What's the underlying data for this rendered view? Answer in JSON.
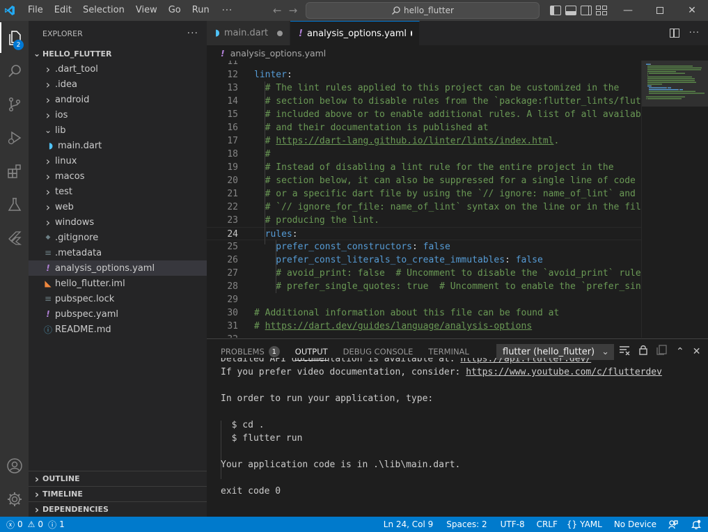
{
  "menu": [
    "File",
    "Edit",
    "Selection",
    "View",
    "Go",
    "Run"
  ],
  "menu_more": "···",
  "command_center": "hello_flutter",
  "activity": {
    "explorer_badge": "2"
  },
  "explorer": {
    "title": "EXPLORER",
    "more": "···",
    "root": "HELLO_FLUTTER",
    "items": [
      {
        "label": ".dart_tool",
        "kind": "folder",
        "icon": "chevron-right-icon"
      },
      {
        "label": ".idea",
        "kind": "folder",
        "icon": "chevron-right-icon"
      },
      {
        "label": "android",
        "kind": "folder",
        "icon": "chevron-right-icon"
      },
      {
        "label": "ios",
        "kind": "folder",
        "icon": "chevron-right-icon"
      },
      {
        "label": "lib",
        "kind": "folder-open",
        "icon": "chevron-down-icon"
      },
      {
        "label": "main.dart",
        "kind": "dart-file",
        "icon": "dart-icon"
      },
      {
        "label": "linux",
        "kind": "folder",
        "icon": "chevron-right-icon"
      },
      {
        "label": "macos",
        "kind": "folder",
        "icon": "chevron-right-icon"
      },
      {
        "label": "test",
        "kind": "folder",
        "icon": "chevron-right-icon"
      },
      {
        "label": "web",
        "kind": "folder",
        "icon": "chevron-right-icon"
      },
      {
        "label": "windows",
        "kind": "folder",
        "icon": "chevron-right-icon"
      },
      {
        "label": ".gitignore",
        "kind": "file",
        "icon": "git-icon"
      },
      {
        "label": ".metadata",
        "kind": "file",
        "icon": "lines-icon"
      },
      {
        "label": "analysis_options.yaml",
        "kind": "yaml",
        "icon": "exclamation-icon"
      },
      {
        "label": "hello_flutter.iml",
        "kind": "file",
        "icon": "rss-icon"
      },
      {
        "label": "pubspec.lock",
        "kind": "file",
        "icon": "lines-icon"
      },
      {
        "label": "pubspec.yaml",
        "kind": "yaml",
        "icon": "exclamation-icon"
      },
      {
        "label": "README.md",
        "kind": "file",
        "icon": "info-icon"
      }
    ],
    "sections": [
      "OUTLINE",
      "TIMELINE",
      "DEPENDENCIES"
    ]
  },
  "tabs": [
    {
      "label": "main.dart",
      "icon": "dart-icon",
      "active": false
    },
    {
      "label": "analysis_options.yaml",
      "icon": "exclamation-icon",
      "active": true
    }
  ],
  "breadcrumb": "analysis_options.yaml",
  "editor": {
    "lines": [
      {
        "n": "11",
        "parts": []
      },
      {
        "n": "12",
        "parts": [
          {
            "t": "linter",
            "c": "k"
          },
          {
            "t": ":",
            "c": "w"
          }
        ]
      },
      {
        "n": "13",
        "parts": [
          {
            "t": "  # The lint rules applied to this project can be customized in the",
            "c": "c"
          }
        ]
      },
      {
        "n": "14",
        "parts": [
          {
            "t": "  # section below to disable rules from the `package:flutter_lints/flutter.yaml`",
            "c": "c"
          }
        ]
      },
      {
        "n": "15",
        "parts": [
          {
            "t": "  # included above or to enable additional rules. A list of all available lints",
            "c": "c"
          }
        ]
      },
      {
        "n": "16",
        "parts": [
          {
            "t": "  # and their documentation is published at",
            "c": "c"
          }
        ]
      },
      {
        "n": "17",
        "parts": [
          {
            "t": "  # ",
            "c": "c"
          },
          {
            "t": "https://dart-lang.github.io/linter/lints/index.html",
            "c": "u"
          },
          {
            "t": ".",
            "c": "c"
          }
        ]
      },
      {
        "n": "18",
        "parts": [
          {
            "t": "  #",
            "c": "c"
          }
        ]
      },
      {
        "n": "19",
        "parts": [
          {
            "t": "  # Instead of disabling a lint rule for the entire project in the",
            "c": "c"
          }
        ]
      },
      {
        "n": "20",
        "parts": [
          {
            "t": "  # section below, it can also be suppressed for a single line of code",
            "c": "c"
          }
        ]
      },
      {
        "n": "21",
        "parts": [
          {
            "t": "  # or a specific dart file by using the `// ignore: name_of_lint` and",
            "c": "c"
          }
        ]
      },
      {
        "n": "22",
        "parts": [
          {
            "t": "  # `// ignore_for_file: name_of_lint` syntax on the line or in the file",
            "c": "c"
          }
        ]
      },
      {
        "n": "23",
        "parts": [
          {
            "t": "  # producing the lint.",
            "c": "c"
          }
        ]
      },
      {
        "n": "24",
        "parts": [
          {
            "t": "  rules",
            "c": "k"
          },
          {
            "t": ":",
            "c": "w"
          }
        ],
        "current": true
      },
      {
        "n": "25",
        "parts": [
          {
            "t": "    prefer_const_constructors",
            "c": "k"
          },
          {
            "t": ": ",
            "c": "w"
          },
          {
            "t": "false",
            "c": "k"
          }
        ]
      },
      {
        "n": "26",
        "parts": [
          {
            "t": "    prefer_const_literals_to_create_immutables",
            "c": "k"
          },
          {
            "t": ": ",
            "c": "w"
          },
          {
            "t": "false",
            "c": "k"
          }
        ]
      },
      {
        "n": "27",
        "parts": [
          {
            "t": "    # avoid_print: false  # Uncomment to disable the `avoid_print` rule",
            "c": "c"
          }
        ]
      },
      {
        "n": "28",
        "parts": [
          {
            "t": "    # prefer_single_quotes: true  # Uncomment to enable the `prefer_single_quotes` rule",
            "c": "c"
          }
        ]
      },
      {
        "n": "29",
        "parts": []
      },
      {
        "n": "30",
        "parts": [
          {
            "t": "# Additional information about this file can be found at",
            "c": "c"
          }
        ]
      },
      {
        "n": "31",
        "parts": [
          {
            "t": "# ",
            "c": "c"
          },
          {
            "t": "https://dart.dev/guides/language/analysis-options",
            "c": "u"
          }
        ]
      },
      {
        "n": "32",
        "parts": []
      }
    ]
  },
  "panel": {
    "tabs": [
      {
        "label": "PROBLEMS",
        "badge": "1",
        "active": false
      },
      {
        "label": "OUTPUT",
        "active": true
      },
      {
        "label": "DEBUG CONSOLE",
        "active": false
      },
      {
        "label": "TERMINAL",
        "active": false
      }
    ],
    "output_channel": "flutter (hello_flutter)",
    "output_lines": [
      {
        "text": "Detailed API documentation is available at: ",
        "link": "https://api.flutter.dev/"
      },
      {
        "text": "If you prefer video documentation, consider: ",
        "link": "https://www.youtube.com/c/flutterdev"
      },
      {
        "text": ""
      },
      {
        "text": "In order to run your application, type:"
      },
      {
        "text": ""
      },
      {
        "text": "  $ cd ."
      },
      {
        "text": "  $ flutter run"
      },
      {
        "text": ""
      },
      {
        "text": "Your application code is in .\\lib\\main.dart."
      },
      {
        "text": ""
      },
      {
        "text": "exit code 0"
      }
    ]
  },
  "status": {
    "errors": "0",
    "warnings": "0",
    "info": "1",
    "position": "Ln 24, Col 9",
    "spaces": "Spaces: 2",
    "encoding": "UTF-8",
    "eol": "CRLF",
    "language": "YAML",
    "device": "No Device"
  },
  "colors": {
    "accent": "#007acc",
    "comment": "#6a9955",
    "keyword": "#569cd6",
    "dart": "#4fc3f7",
    "yaml": "#b180d7",
    "rss": "#f0883e"
  }
}
